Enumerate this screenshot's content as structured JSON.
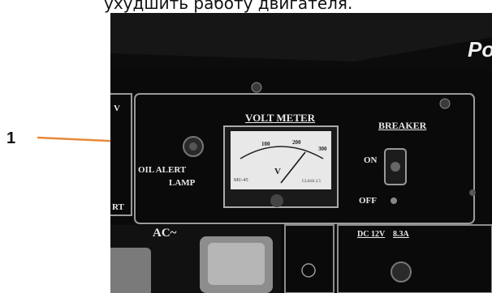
{
  "caption": "ухудшить работу двигателя.",
  "callout": {
    "number": "1",
    "color": "#e8883a"
  },
  "panel": {
    "brand_fragment": "Po",
    "voltmeter_title": "VOLT METER",
    "breaker_title": "BREAKER",
    "breaker_on": "ON",
    "breaker_off": "OFF",
    "oil_label_line1": "OIL ALERT",
    "oil_label_line2": "LAMP",
    "ac_label": "AC~",
    "dc_label": "DC 12V",
    "dc_amps": "8.3A",
    "left_fragment_top": "V",
    "left_fragment_bottom": "RT",
    "gauge_ticks": [
      "100",
      "200",
      "300"
    ],
    "gauge_unit": "V",
    "gauge_left_text": "MU-45",
    "gauge_right_text": "CLASS 2.5"
  }
}
